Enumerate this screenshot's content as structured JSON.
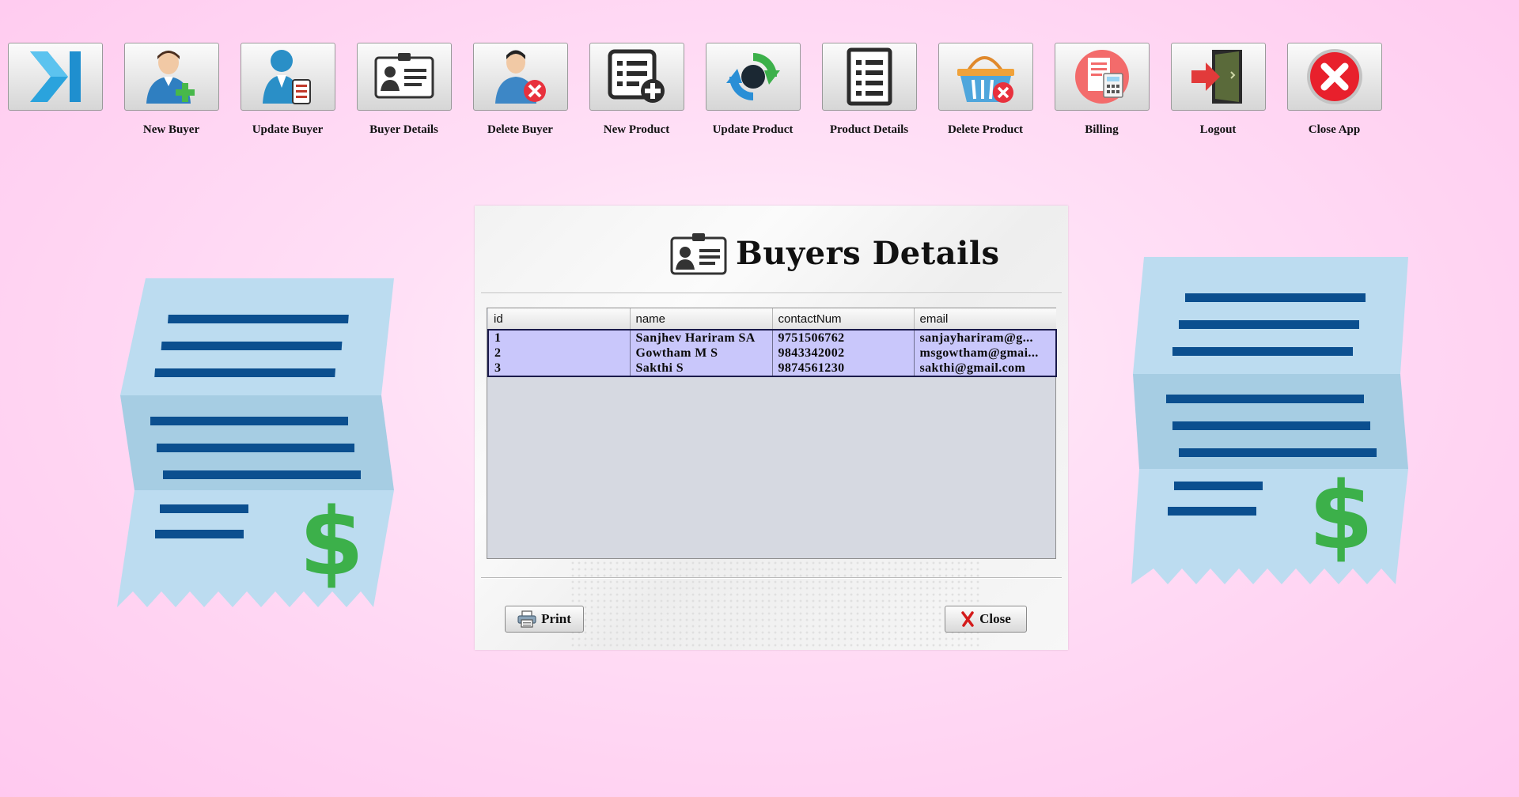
{
  "toolbar": {
    "items": [
      {
        "label": "",
        "icon": "expand-icon"
      },
      {
        "label": "New Buyer",
        "icon": "user-add-icon"
      },
      {
        "label": "Update Buyer",
        "icon": "user-edit-icon"
      },
      {
        "label": "Buyer Details",
        "icon": "id-card-icon"
      },
      {
        "label": "Delete Buyer",
        "icon": "user-delete-icon"
      },
      {
        "label": "New Product",
        "icon": "list-add-icon"
      },
      {
        "label": "Update Product",
        "icon": "refresh-icon"
      },
      {
        "label": "Product Details",
        "icon": "list-icon"
      },
      {
        "label": "Delete Product",
        "icon": "basket-delete-icon"
      },
      {
        "label": "Billing",
        "icon": "billing-icon"
      },
      {
        "label": "Logout",
        "icon": "logout-door-icon"
      },
      {
        "label": "Close App",
        "icon": "close-circle-icon"
      }
    ]
  },
  "dialog": {
    "title": "Buyers Details",
    "table": {
      "columns": [
        "id",
        "name",
        "contactNum",
        "email"
      ],
      "rows": [
        [
          "1",
          "Sanjhev Hariram SA",
          "9751506762",
          "sanjayhariram@g..."
        ],
        [
          "2",
          "Gowtham M S",
          "9843342002",
          "msgowtham@gmai..."
        ],
        [
          "3",
          "Sakthi S",
          "9874561230",
          "sakthi@gmail.com"
        ]
      ]
    },
    "print_label": "Print",
    "close_label": "Close"
  },
  "colors": {
    "background": "#ffd6f2",
    "row_selected": "#c9c7fb",
    "table_empty": "#d6d9e1",
    "receipt": "#bcdcf0",
    "receipt_line": "#0b4f8f",
    "dollar": "#3cb04a"
  }
}
